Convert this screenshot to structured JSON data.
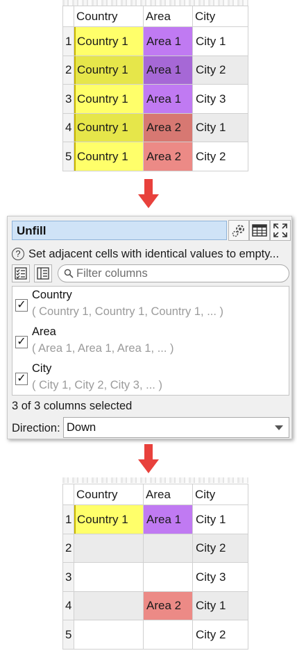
{
  "before_grid": {
    "headers": [
      "",
      "Country",
      "Area",
      "City"
    ],
    "rows": [
      {
        "num": "1",
        "country": "Country 1",
        "area": "Area 1",
        "city": "City 1"
      },
      {
        "num": "2",
        "country": "Country 1",
        "area": "Area 1",
        "city": "City 2"
      },
      {
        "num": "3",
        "country": "Country 1",
        "area": "Area 1",
        "city": "City 3"
      },
      {
        "num": "4",
        "country": "Country 1",
        "area": "Area 2",
        "city": "City 1"
      },
      {
        "num": "5",
        "country": "Country 1",
        "area": "Area 2",
        "city": "City 2"
      }
    ]
  },
  "panel": {
    "title": "Unfill",
    "description": "Set adjacent cells with identical values to empty...",
    "filter_placeholder": "Filter columns",
    "columns": [
      {
        "name": "Country",
        "sample": "( Country 1, Country 1, Country 1, ... )",
        "checked": true
      },
      {
        "name": "Area",
        "sample": "( Area 1, Area 1, Area 1, ... )",
        "checked": true
      },
      {
        "name": "City",
        "sample": "( City 1, City 2, City 3, ... )",
        "checked": true
      }
    ],
    "status": "3 of 3 columns selected",
    "direction_label": "Direction:",
    "direction_value": "Down",
    "icons": [
      "gear-icon",
      "table-icon",
      "expand-icon",
      "help-icon",
      "checklist-icon",
      "column-list-icon",
      "search-icon"
    ]
  },
  "after_grid": {
    "headers": [
      "",
      "Country",
      "Area",
      "City"
    ],
    "rows": [
      {
        "num": "1",
        "country": "Country 1",
        "area": "Area 1",
        "city": "City 1"
      },
      {
        "num": "2",
        "country": "",
        "area": "",
        "city": "City 2"
      },
      {
        "num": "3",
        "country": "",
        "area": "",
        "city": "City 3"
      },
      {
        "num": "4",
        "country": "",
        "area": "Area 2",
        "city": "City 1"
      },
      {
        "num": "5",
        "country": "",
        "area": "",
        "city": "City 2"
      }
    ]
  },
  "colors": {
    "country_fill": "#ffff6a",
    "area1_fill": "#c07af2",
    "area2_fill": "#ec8a86",
    "arrow": "#e8413c",
    "title_field": "#cfe3f7"
  }
}
